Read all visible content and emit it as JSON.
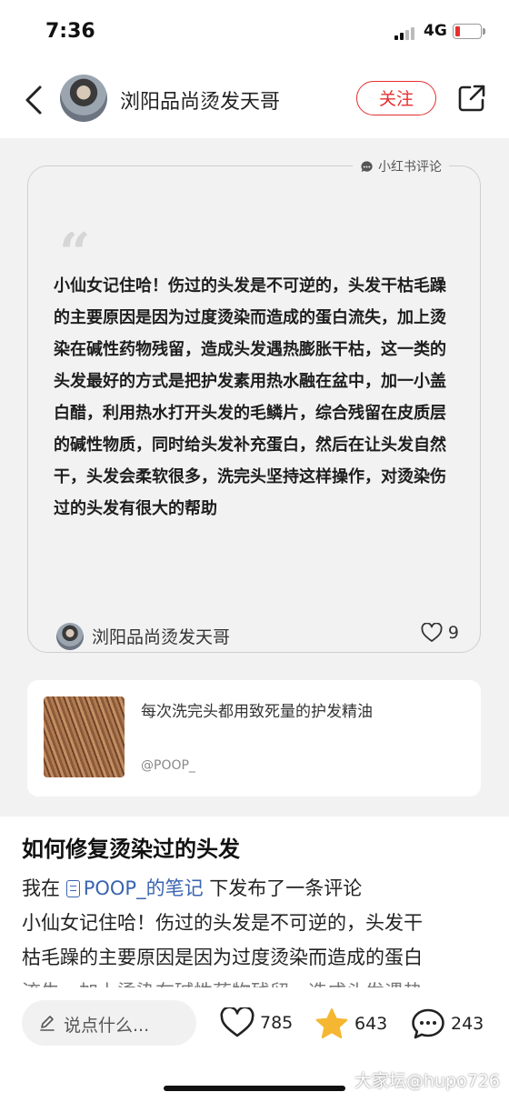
{
  "status_bar": {
    "time": "7:36",
    "network": "4G"
  },
  "header": {
    "author_name": "浏阳品尚烫发天哥",
    "follow_label": "关注"
  },
  "comment_card": {
    "tag": "小红书评论",
    "text": "小仙女记住哈！伤过的头发是不可逆的，头发干枯毛躁的主要原因是因为过度烫染而造成的蛋白流失，加上烫染在碱性药物残留，造成头发遇热膨胀干枯，这一类的头发最好的方式是把护发素用热水融在盆中，加一小盖白醋，利用热水打开头发的毛鳞片，综合残留在皮质层的碱性物质，同时给头发补充蛋白，然后在让头发自然干，头发会柔软很多，洗完头坚持这样操作，对烫染伤过的头发有很大的帮助",
    "author": "浏阳品尚烫发天哥",
    "likes": "9"
  },
  "linked_note": {
    "title": "每次洗完头都用致死量的护发精油",
    "user": "@POOP_"
  },
  "content": {
    "title": "如何修复烫染过的头发",
    "intro_prefix": "我在",
    "note_link": "POOP_的笔记",
    "intro_suffix": " 下发布了一条评论",
    "line1": "小仙女记住哈！伤过的头发是不可逆的，头发干",
    "line2": "枯毛躁的主要原因是因为过度烫染而造成的蛋白",
    "line3_partial": "流失，加上烫染在碱性药物残留，造成头发遇热"
  },
  "bottom_bar": {
    "input_placeholder": "说点什么...",
    "likes": "785",
    "collects": "643",
    "comments": "243"
  },
  "watermark": "大家坛@hupo726",
  "colors": {
    "accent": "#e5302f",
    "link": "#3a64b0",
    "star": "#f5b731"
  }
}
